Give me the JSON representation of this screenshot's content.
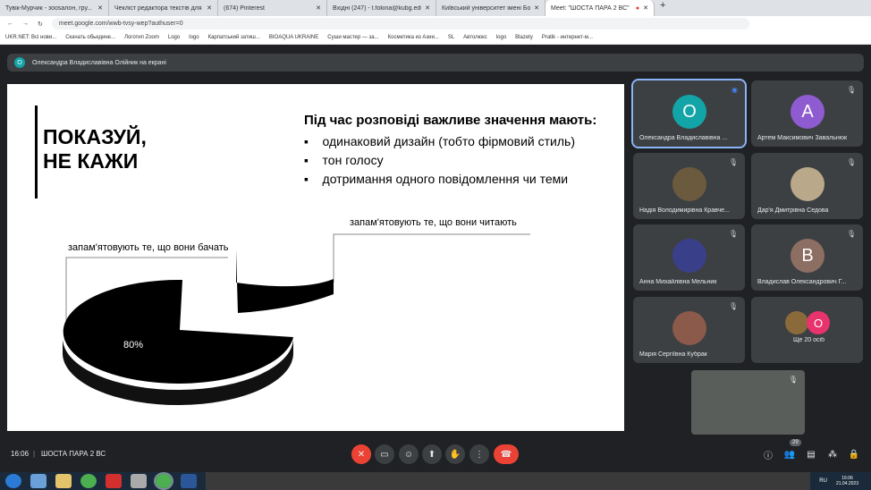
{
  "browser": {
    "tabs": [
      {
        "label": "Тувік-Мурчик - зооsалон, гру..."
      },
      {
        "label": "Чекліст редактора текстів для н..."
      },
      {
        "label": "(674) Pinterest"
      },
      {
        "label": "Вхідні (247) - t.fokina@kubg.edu..."
      },
      {
        "label": "Київський університет імені Бо..."
      },
      {
        "label": "Meet: \"ШОСТА ПАРА 2 ВС\""
      }
    ],
    "url": "meet.google.com/wwb-tvsy-wep?authuser=0",
    "bookmarks": [
      "UKR.NET: Всі нови...",
      "Скачать обьедине...",
      "Логотип Zoom",
      "Logo",
      "logo",
      "Карпатський затиш...",
      "BIOAQUA UKRAINE",
      "Суши мастер — за...",
      "Косметика из Азии...",
      "SL",
      "Автолюкс",
      "logo",
      "Blazety",
      "Pratik - интернет-м..."
    ]
  },
  "presenter": {
    "initial": "О",
    "text": "Олександра Владиславівна Олійник на екрані"
  },
  "slide": {
    "title_line1": "ПОКАЗУЙ,",
    "title_line2": "НЕ КАЖИ",
    "heading": "Під час розповіді важливе значення мають:",
    "bullets": [
      "одинаковий дизайн (тобто фірмовий стиль)",
      "тон голосу",
      "дотримання одного повідомлення чи теми"
    ],
    "pie": {
      "label_read": "запам'ятовують те, що вони читають",
      "label_see": "запам'ятовують те, що вони бачать",
      "value_read": "20%",
      "value_see": "80%",
      "values": [
        20,
        80
      ]
    }
  },
  "participants": [
    {
      "name": "Олександра Владиславівна ...",
      "initial": "О",
      "color": "#12a4a6"
    },
    {
      "name": "Артем Максимович Завальнюк",
      "initial": "А",
      "color": "#8e5bd0"
    },
    {
      "name": "Надія Володимирівна Кравче...",
      "initial": "",
      "color": "#6b5a3e"
    },
    {
      "name": "Дар'я Дмитрівна Седова",
      "initial": "",
      "color": "#b9a98a"
    },
    {
      "name": "Анна Михайлівна Мельник",
      "initial": "",
      "color": "#3a3f8a"
    },
    {
      "name": "Владислав Олександрович Г...",
      "initial": "В",
      "color": "#8d6e63"
    },
    {
      "name": "Марія Сергіївна Кубрак",
      "initial": "",
      "color": "#8b5a4a"
    },
    {
      "name": "Ще 20 осіб",
      "initial": "О",
      "color": "#e8336d"
    }
  ],
  "controls": {
    "time": "16:06",
    "meeting": "ШОСТА ПАРА 2 ВС",
    "people_count": "29"
  },
  "taskbar": {
    "lang": "RU",
    "time": "16:06",
    "date": "21.04.2023"
  }
}
